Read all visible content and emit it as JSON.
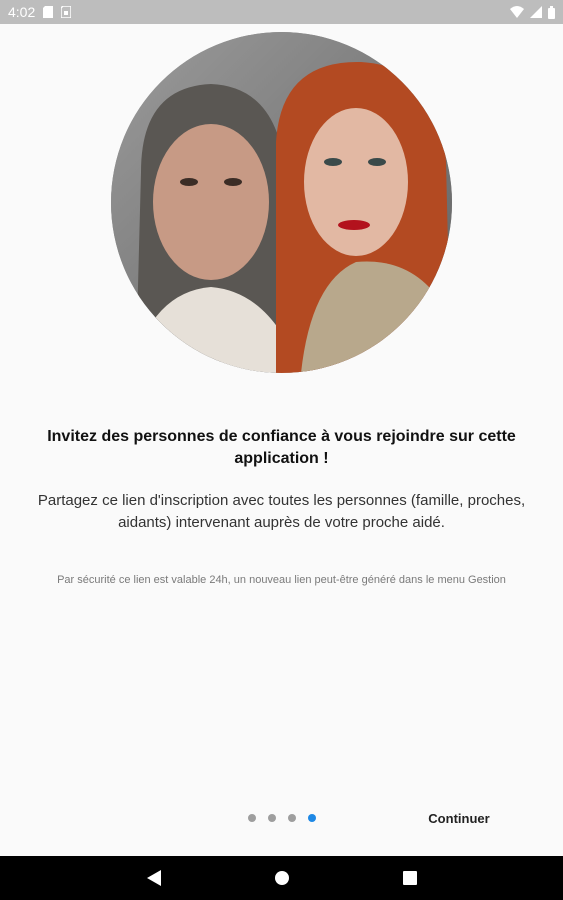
{
  "status_bar": {
    "time": "4:02",
    "icons_left": [
      "sd-card-icon",
      "sim-icon"
    ],
    "icons_right": [
      "wifi-icon",
      "signal-icon",
      "battery-icon"
    ]
  },
  "hero_image": {
    "description_icon": "portrait-photo",
    "shape": "circle"
  },
  "onboarding": {
    "title": "Invitez des personnes de confiance à vous rejoindre sur cette application !",
    "subtitle": "Partagez ce lien d'inscription avec toutes les personnes (famille, proches, aidants) intervenant auprès de votre proche aidé.",
    "note": "Par sécurité ce lien est valable 24h, un nouveau lien peut-être généré dans le menu Gestion"
  },
  "pager": {
    "total": 4,
    "active_index": 3
  },
  "actions": {
    "continue_label": "Continuer"
  },
  "colors": {
    "accent": "#1e88e5",
    "status_bar": "#bdbdbd",
    "nav_bar": "#000000",
    "background": "#fafafa"
  },
  "nav_bar": {
    "buttons": [
      "back-icon",
      "home-icon",
      "recents-icon"
    ]
  }
}
